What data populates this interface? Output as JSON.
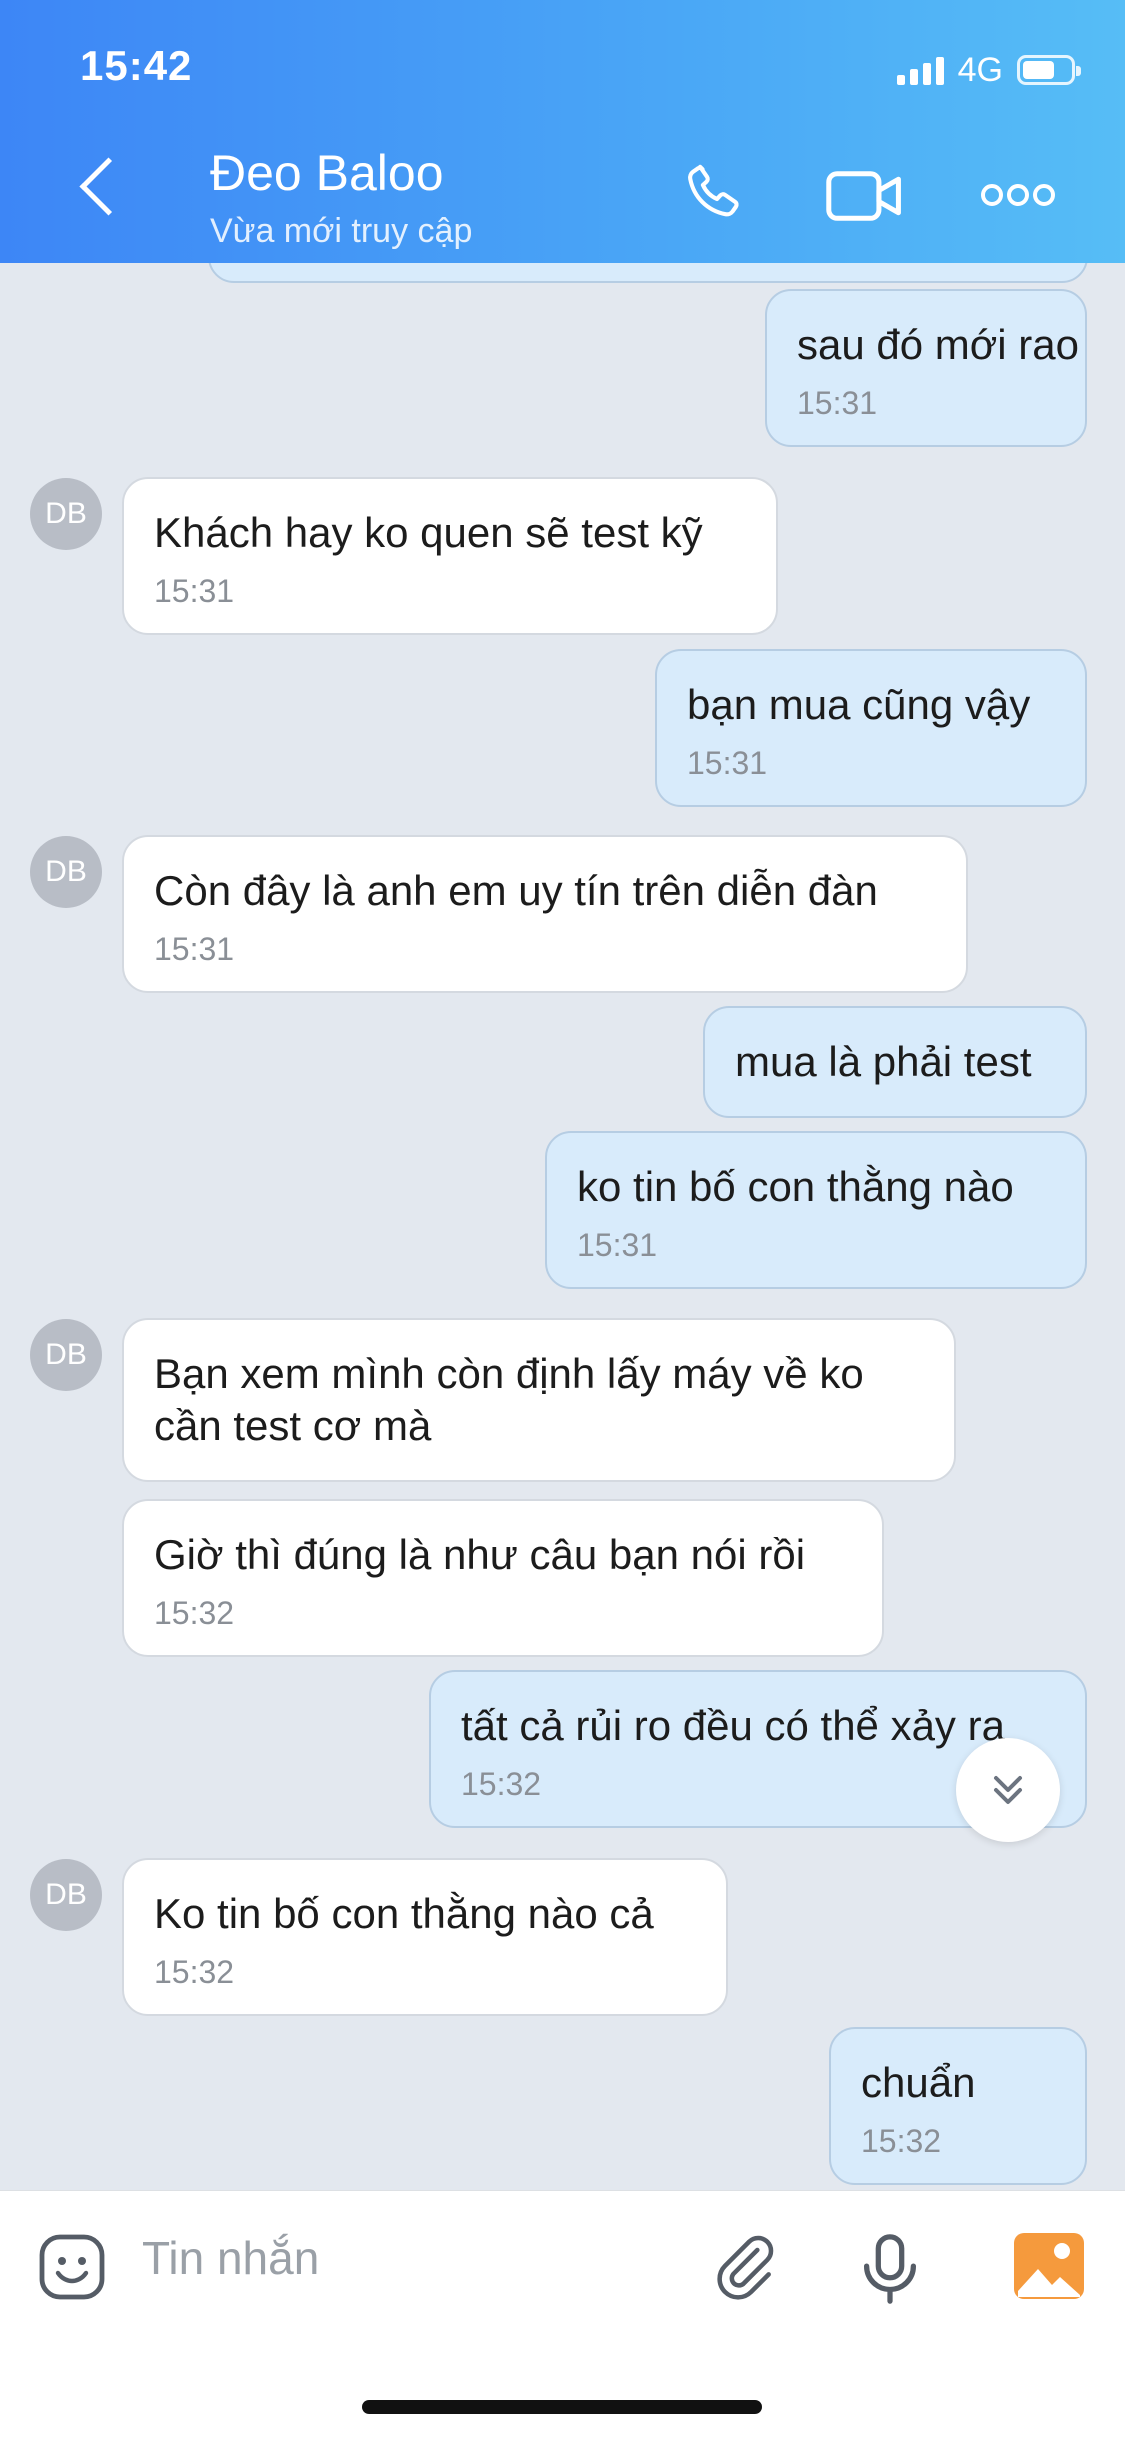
{
  "status": {
    "time": "15:42",
    "network": "4G"
  },
  "header": {
    "title": "Đeo Baloo",
    "subtitle": "Vừa mới truy cập"
  },
  "avatar_initials": "DB",
  "messages": [
    {
      "text": "sau đó mới rao",
      "time": "15:31"
    },
    {
      "text": "Khách hay ko quen sẽ test kỹ",
      "time": "15:31"
    },
    {
      "text": "bạn mua cũng vậy",
      "time": "15:31"
    },
    {
      "text": "Còn đây là anh em uy tín trên diễn đàn",
      "time": "15:31"
    },
    {
      "text": "mua là phải test"
    },
    {
      "text": "ko tin bố con thằng nào",
      "time": "15:31"
    },
    {
      "line1": "Bạn xem mình còn định lấy máy về ko",
      "line2": "cần test cơ mà"
    },
    {
      "text": "Giờ thì đúng là như câu bạn nói rồi",
      "time": "15:32"
    },
    {
      "text": "tất cả rủi ro đều có thể xảy ra",
      "time": "15:32"
    },
    {
      "text": "Ko tin bố con thằng nào cả",
      "time": "15:32"
    },
    {
      "text": "chuẩn",
      "time": "15:32"
    }
  ],
  "composer": {
    "placeholder": "Tin nhắn"
  },
  "icons": [
    "back-chevron-icon",
    "phone-icon",
    "video-call-icon",
    "more-icon",
    "scroll-down-icon",
    "sticker-icon",
    "attachment-icon",
    "microphone-icon",
    "gallery-icon"
  ]
}
